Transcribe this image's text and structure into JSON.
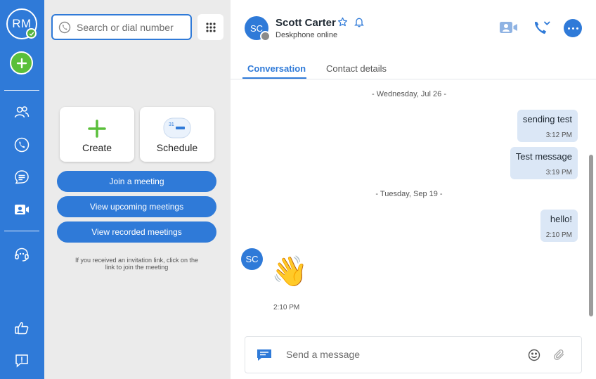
{
  "user": {
    "initials": "RM",
    "presence": "online"
  },
  "rail": {
    "add_button": "add-icon",
    "items": [
      {
        "name": "contacts",
        "icon": "people-icon"
      },
      {
        "name": "calls",
        "icon": "phone-icon"
      },
      {
        "name": "messages",
        "icon": "chat-icon"
      },
      {
        "name": "meetings",
        "icon": "video-contact-icon",
        "active": true
      },
      {
        "name": "voicemail",
        "icon": "headset-icon"
      },
      {
        "name": "feedback",
        "icon": "thumbs-up-icon"
      },
      {
        "name": "report",
        "icon": "report-issue-icon"
      }
    ]
  },
  "search": {
    "placeholder": "Search or dial number"
  },
  "meetings": {
    "create_label": "Create",
    "schedule_label": "Schedule",
    "calendar_day": "31",
    "join_label": "Join a meeting",
    "upcoming_label": "View upcoming meetings",
    "recorded_label": "View recorded meetings",
    "hint": "If you received an invitation link, click on the link to join the meeting"
  },
  "contact": {
    "initials": "SC",
    "name": "Scott Carter",
    "status": "Deskphone online"
  },
  "tabs": [
    {
      "label": "Conversation",
      "active": true
    },
    {
      "label": "Contact details",
      "active": false
    }
  ],
  "messages": {
    "date1": "- Wednesday, Jul 26 -",
    "msg1": {
      "text": "sending test",
      "time": "3:12 PM"
    },
    "msg2": {
      "text": "Test message",
      "time": "3:19 PM"
    },
    "date2": "- Tuesday, Sep 19 -",
    "msg3": {
      "text": "hello!",
      "time": "2:10 PM"
    },
    "incoming": {
      "sender_initials": "SC",
      "emoji": "👋",
      "time": "2:10 PM"
    }
  },
  "composer": {
    "placeholder": "Send a message"
  },
  "colors": {
    "brand": "#2f7ad8",
    "accent_green": "#5abf3a",
    "bubble": "#dbe7f6",
    "panel": "#ebebeb"
  }
}
